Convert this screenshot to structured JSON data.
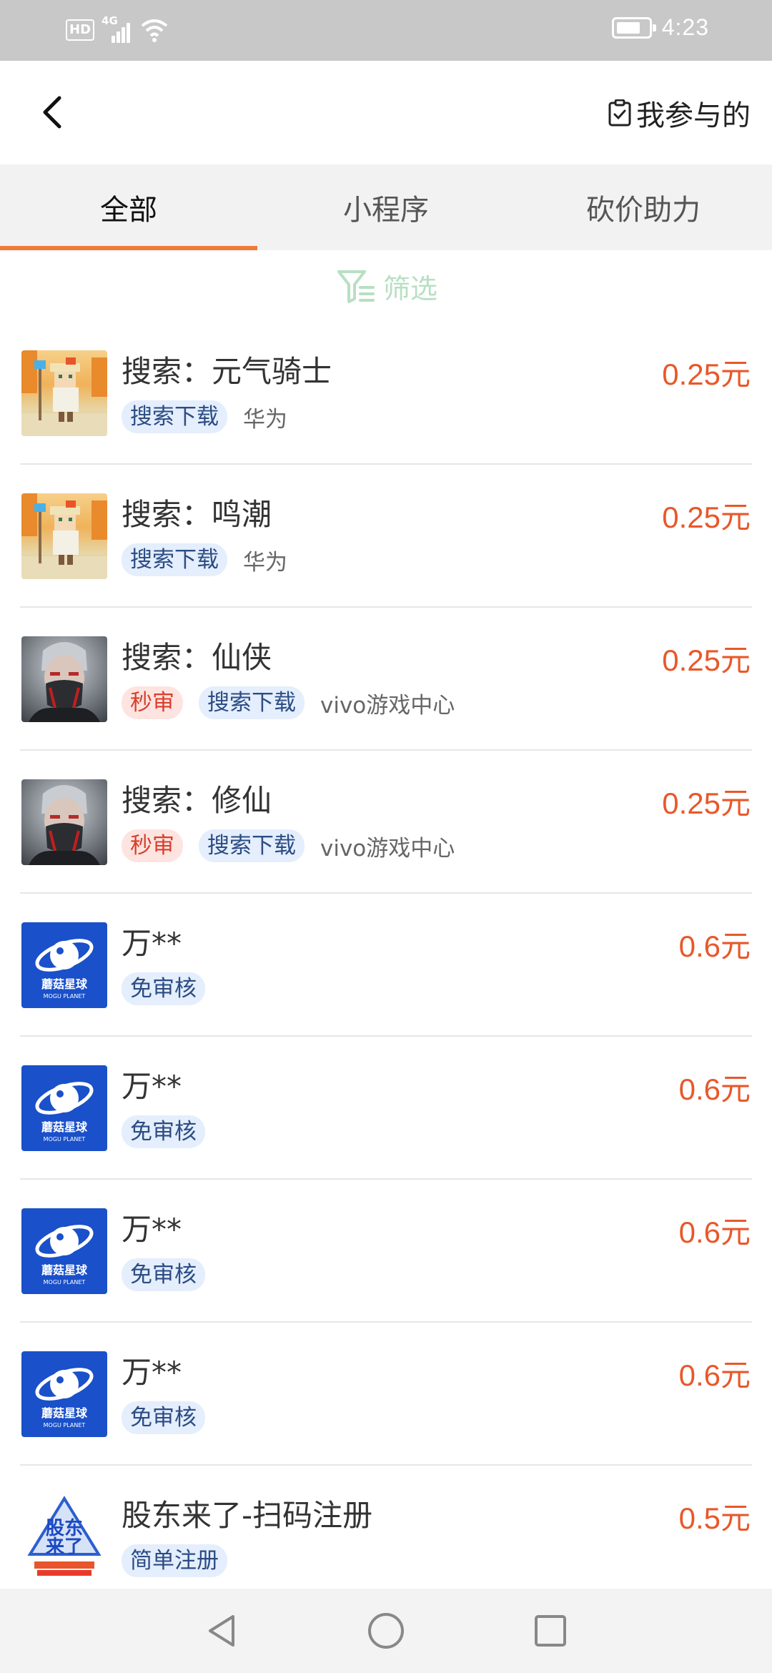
{
  "status_bar": {
    "hd": "HD",
    "network": "4G",
    "time": "4:23",
    "icons": [
      "signal-icon",
      "wifi-icon",
      "battery-icon"
    ]
  },
  "header": {
    "back_icon": "chevron-left-icon",
    "participated_label": "我参与的",
    "participated_icon": "clipboard-check-icon"
  },
  "tabs": [
    {
      "label": "全部",
      "active": true
    },
    {
      "label": "小程序",
      "active": false
    },
    {
      "label": "砍价助力",
      "active": false
    }
  ],
  "filter": {
    "label": "筛选",
    "icon": "filter-icon",
    "color": "#b8dfc2"
  },
  "colors": {
    "price": "#e8582a",
    "tab_indicator": "#f07a3a",
    "tag_blue_bg": "#e4eefc",
    "tag_red_bg": "#fde4e1"
  },
  "items": [
    {
      "title": "搜索：元气骑士",
      "price": "0.25元",
      "tag_red": "",
      "tag_blue": "搜索下载",
      "platform": "华为",
      "thumb": "pixel-knight-image"
    },
    {
      "title": "搜索：鸣潮",
      "price": "0.25元",
      "tag_red": "",
      "tag_blue": "搜索下载",
      "platform": "华为",
      "thumb": "pixel-knight-image"
    },
    {
      "title": "搜索：仙侠",
      "price": "0.25元",
      "tag_red": "秒审",
      "tag_blue": "搜索下载",
      "platform": "vivo游戏中心",
      "thumb": "masked-character-image"
    },
    {
      "title": "搜索：修仙",
      "price": "0.25元",
      "tag_red": "秒审",
      "tag_blue": "搜索下载",
      "platform": "vivo游戏中心",
      "thumb": "masked-character-image"
    },
    {
      "title": "万**",
      "price": "0.6元",
      "tag_red": "",
      "tag_blue": "免审核",
      "platform": "",
      "thumb": "mogu-planet-logo"
    },
    {
      "title": "万**",
      "price": "0.6元",
      "tag_red": "",
      "tag_blue": "免审核",
      "platform": "",
      "thumb": "mogu-planet-logo"
    },
    {
      "title": "万**",
      "price": "0.6元",
      "tag_red": "",
      "tag_blue": "免审核",
      "platform": "",
      "thumb": "mogu-planet-logo"
    },
    {
      "title": "万**",
      "price": "0.6元",
      "tag_red": "",
      "tag_blue": "免审核",
      "platform": "",
      "thumb": "mogu-planet-logo"
    },
    {
      "title": "股东来了-扫码注册",
      "price": "0.5元",
      "tag_red": "",
      "tag_blue": "简单注册",
      "platform": "",
      "thumb": "gudong-laile-logo"
    }
  ],
  "logo_text": {
    "mogu_cn": "蘑菇星球",
    "mogu_en": "MOGU PLANET",
    "gudong": "股东来了"
  },
  "nav_bar": {
    "icons": [
      "back-triangle-icon",
      "home-circle-icon",
      "recents-square-icon"
    ]
  }
}
